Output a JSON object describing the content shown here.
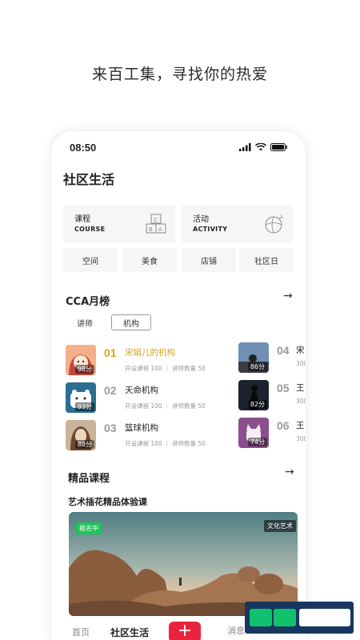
{
  "tagline": "来百工集，寻找你的热爱",
  "status": {
    "time": "08:50"
  },
  "page_title": "社区生活",
  "cards": {
    "course": {
      "cn": "课程",
      "en": "COURSE",
      "icon": "toy-blocks-icon"
    },
    "activity": {
      "cn": "活动",
      "en": "ACTIVITY",
      "icon": "ball-icon"
    },
    "small": [
      "空间",
      "美食",
      "店铺",
      "社区日"
    ]
  },
  "monthly": {
    "title": "CCA月榜",
    "tabs": [
      "讲师",
      "机构"
    ],
    "active_tab": "机构",
    "left_rows": [
      {
        "rank": "01",
        "name": "宋娟儿的机构",
        "score": "98分",
        "meta": "开设课程 100 ｜ 讲师数量 50",
        "highlight": true
      },
      {
        "rank": "02",
        "name": "天命机构",
        "score": "93分",
        "meta": "开设课程 100 ｜ 讲师数量 50",
        "highlight": false
      },
      {
        "rank": "03",
        "name": "篮球机构",
        "score": "88分",
        "meta": "开设课程 100 ｜ 讲师数量 50",
        "highlight": false
      }
    ],
    "right_rows": [
      {
        "rank": "04",
        "name": "宋",
        "score": "86分",
        "meta": "300"
      },
      {
        "rank": "05",
        "name": "王",
        "score": "82分",
        "meta": "300"
      },
      {
        "rank": "06",
        "name": "王",
        "score": "74分",
        "meta": "300"
      }
    ]
  },
  "featured": {
    "title": "精品课程",
    "course_title": "艺术插花精品体验课",
    "badge_status": "报名中",
    "badge_category": "文化艺术"
  },
  "tabbar": {
    "home": "首页",
    "community": "社区生活",
    "plus": "+",
    "messages": "消息"
  },
  "colors": {
    "accent_red": "#e8243a",
    "gold": "#d6a619",
    "green": "#1ec45a"
  }
}
